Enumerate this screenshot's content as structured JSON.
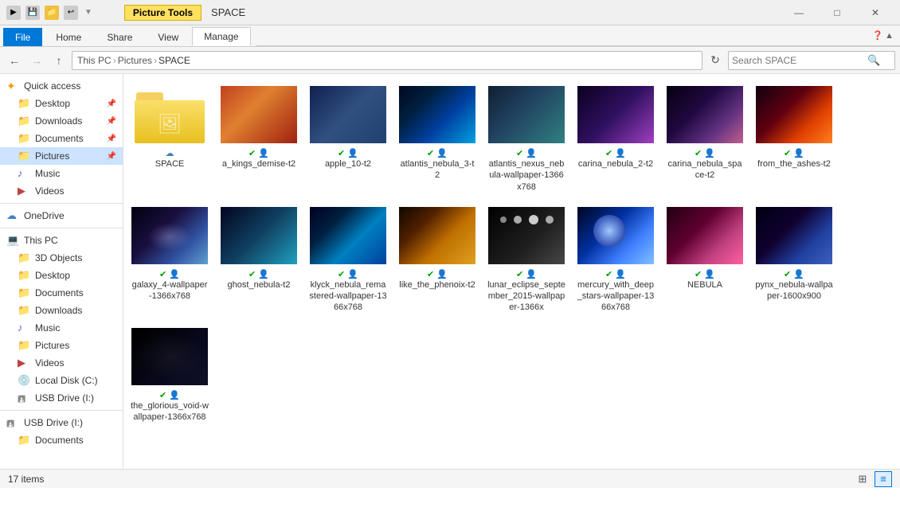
{
  "titleBar": {
    "title": "SPACE",
    "minimize": "—",
    "maximize": "□",
    "close": "✕"
  },
  "ribbon": {
    "pictureToolsLabel": "Picture Tools",
    "tabs": [
      {
        "id": "file",
        "label": "File",
        "active": true
      },
      {
        "id": "home",
        "label": "Home"
      },
      {
        "id": "share",
        "label": "Share"
      },
      {
        "id": "view",
        "label": "View"
      },
      {
        "id": "manage",
        "label": "Manage"
      }
    ]
  },
  "navBar": {
    "backDisabled": false,
    "forwardDisabled": true,
    "upLabel": "↑",
    "addressParts": [
      "This PC",
      "Pictures",
      "SPACE"
    ],
    "searchPlaceholder": "Search SPACE"
  },
  "sidebar": {
    "sections": [
      {
        "items": [
          {
            "id": "quick-access",
            "label": "Quick access",
            "iconType": "star",
            "indent": 0
          },
          {
            "id": "desktop",
            "label": "Desktop",
            "iconType": "folder-blue",
            "indent": 1,
            "pinned": true
          },
          {
            "id": "downloads",
            "label": "Downloads",
            "iconType": "folder-blue",
            "indent": 1,
            "pinned": true
          },
          {
            "id": "documents",
            "label": "Documents",
            "iconType": "folder-blue",
            "indent": 1,
            "pinned": true
          },
          {
            "id": "pictures",
            "label": "Pictures",
            "iconType": "folder-blue",
            "indent": 1,
            "pinned": true,
            "selected": true
          },
          {
            "id": "music",
            "label": "Music",
            "iconType": "music",
            "indent": 1
          },
          {
            "id": "videos",
            "label": "Videos",
            "iconType": "video",
            "indent": 1
          }
        ]
      },
      {
        "items": [
          {
            "id": "onedrive",
            "label": "OneDrive",
            "iconType": "cloud",
            "indent": 0
          }
        ]
      },
      {
        "items": [
          {
            "id": "this-pc",
            "label": "This PC",
            "iconType": "pc",
            "indent": 0
          },
          {
            "id": "3d-objects",
            "label": "3D Objects",
            "iconType": "folder",
            "indent": 1
          },
          {
            "id": "desktop2",
            "label": "Desktop",
            "iconType": "folder-blue",
            "indent": 1
          },
          {
            "id": "documents2",
            "label": "Documents",
            "iconType": "folder-blue",
            "indent": 1
          },
          {
            "id": "downloads2",
            "label": "Downloads",
            "iconType": "folder-blue",
            "indent": 1
          },
          {
            "id": "music2",
            "label": "Music",
            "iconType": "music",
            "indent": 1
          },
          {
            "id": "pictures2",
            "label": "Pictures",
            "iconType": "folder-blue",
            "indent": 1
          },
          {
            "id": "videos2",
            "label": "Videos",
            "iconType": "video",
            "indent": 1
          },
          {
            "id": "local-disk",
            "label": "Local Disk (C:)",
            "iconType": "drive",
            "indent": 1
          },
          {
            "id": "usb-drive-i",
            "label": "USB Drive (I:)",
            "iconType": "drive",
            "indent": 1
          },
          {
            "id": "usb-drive-i2",
            "label": "USB Drive (I:)",
            "iconType": "drive",
            "indent": 0
          },
          {
            "id": "documents3",
            "label": "Documents",
            "iconType": "folder",
            "indent": 1
          }
        ]
      }
    ]
  },
  "fileGrid": {
    "items": [
      {
        "id": "space-folder",
        "type": "folder",
        "name": "SPACE",
        "hasCloudIcon": true
      },
      {
        "id": "a-kings",
        "type": "image",
        "name": "a_kings_demise-t2",
        "gradient": "linear-gradient(135deg,#c04020 0%,#e08030 40%,#a02010 100%)",
        "badgeGreen": true,
        "badgePerson": true
      },
      {
        "id": "apple-10",
        "type": "image",
        "name": "apple_10-t2",
        "gradient": "linear-gradient(135deg,#102050 0%,#305080 50%,#204070 100%)",
        "badgeGreen": true,
        "badgePerson": true
      },
      {
        "id": "atlantis-3",
        "type": "image",
        "name": "atlantis_nebula_3-t2",
        "gradient": "linear-gradient(135deg,#000820 0%,#002040 30%,#0040a0 60%,#00a0e0 100%)",
        "badgeGreen": true,
        "badgePerson": true
      },
      {
        "id": "atlantis-nexus",
        "type": "image",
        "name": "atlantis_nexus_nebula-wallpaper-1366x768",
        "gradient": "linear-gradient(135deg,#102030 0%,#204060 40%,#308080 100%)",
        "badgeGreen": true,
        "badgePerson": true
      },
      {
        "id": "carina-1",
        "type": "image",
        "name": "carina_nebula_2-t2",
        "gradient": "linear-gradient(135deg,#0a0020 0%,#301060 50%,#a040c0 100%)",
        "badgeGreen": true,
        "badgePerson": true
      },
      {
        "id": "carina-space",
        "type": "image",
        "name": "carina_nebula_space-t2",
        "gradient": "linear-gradient(135deg,#050010 0%,#200840 40%,#603080 70%,#c06090 100%)",
        "badgeGreen": true,
        "badgePerson": true
      },
      {
        "id": "from-ashes",
        "type": "image",
        "name": "from_the_ashes-t2",
        "gradient": "linear-gradient(135deg,#100010 0%,#600010 40%,#e04000 70%,#ff8020 100%)",
        "badgeGreen": true,
        "badgePerson": true
      },
      {
        "id": "galaxy-4",
        "type": "image",
        "name": "galaxy_4-wallpaper-1366x768",
        "gradient": "linear-gradient(135deg,#000010 0%,#1a1040 40%,#3050a0 70%,#60a0d0 100%)",
        "badgeGreen": true,
        "badgePerson": true
      },
      {
        "id": "ghost-nebula",
        "type": "image",
        "name": "ghost_nebula-t2",
        "gradient": "linear-gradient(135deg,#020420 0%,#104060 50%,#20a0c0 100%)",
        "badgeGreen": true,
        "badgePerson": true
      },
      {
        "id": "klyck",
        "type": "image",
        "name": "klyck_nebula_remastered-wallpaper-1366x768",
        "gradient": "linear-gradient(135deg,#000020 0%,#002040 30%,#0080c0 60%,#0040a0 100%)",
        "badgeGreen": true,
        "badgePerson": true
      },
      {
        "id": "like-phoenix",
        "type": "image",
        "name": "like_the_phenoix-t2",
        "gradient": "linear-gradient(135deg,#100800 0%,#502000 30%,#c07000 60%,#e0a020 100%)",
        "badgeGreen": true,
        "badgePerson": true
      },
      {
        "id": "lunar-eclipse",
        "type": "image",
        "name": "lunar_eclipse_september_2015-wallpaper-1366x",
        "gradient": "linear-gradient(135deg,#000000 0%,#101010 30%,#202020 60%,#484848 100%)",
        "badgeGreen": true,
        "badgePerson": true
      },
      {
        "id": "mercury",
        "type": "image",
        "name": "mercury_with_deep_stars-wallpaper-1366x768",
        "gradient": "linear-gradient(135deg,#000420 0%,#0030a0 40%,#4080ff 70%,#80c0ff 100%)",
        "badgeGreen": true,
        "badgePerson": true
      },
      {
        "id": "nebula",
        "type": "image",
        "name": "NEBULA",
        "gradient": "linear-gradient(135deg,#200010 0%,#600030 40%,#c04080 70%,#ff60a0 100%)",
        "badgeGreen": true,
        "badgePerson": false
      },
      {
        "id": "pynx",
        "type": "image",
        "name": "pynx_nebula-wallpaper-1600x900",
        "gradient": "linear-gradient(135deg,#000010 0%,#100030 40%,#2040a0 70%,#4060c0 100%)",
        "badgeGreen": true,
        "badgePerson": true
      },
      {
        "id": "glorious-void",
        "type": "image",
        "name": "the_glorious_void-wallpaper-1366x768",
        "gradient": "linear-gradient(135deg,#000000 0%,#050510 40%,#0a0a20 70%,#101028 100%)",
        "badgeGreen": true,
        "badgePerson": true
      }
    ]
  },
  "statusBar": {
    "itemCount": "17 items",
    "viewGrid": "▦",
    "viewList": "☰"
  }
}
